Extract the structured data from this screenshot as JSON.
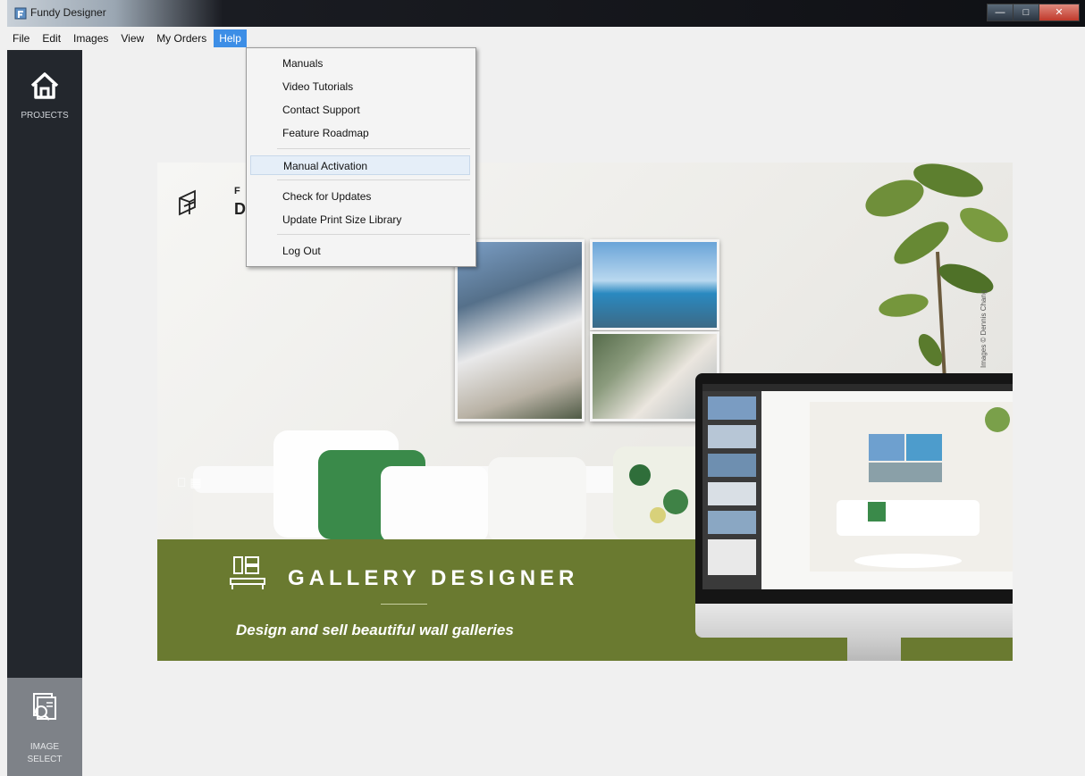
{
  "window": {
    "title": "Fundy Designer",
    "controls": [
      "minimize-icon",
      "maximize-icon",
      "close-icon"
    ]
  },
  "menubar": {
    "items": [
      {
        "label": "File",
        "active": false
      },
      {
        "label": "Edit",
        "active": false
      },
      {
        "label": "Images",
        "active": false
      },
      {
        "label": "View",
        "active": false
      },
      {
        "label": "My Orders",
        "active": false
      },
      {
        "label": "Help",
        "active": true
      }
    ]
  },
  "sidebar": {
    "projects_label": "PROJECTS",
    "image_label": "IMAGE",
    "image_label_2": "SELECT"
  },
  "help_menu": {
    "items": [
      {
        "label": "Manuals"
      },
      {
        "label": "Video Tutorials"
      },
      {
        "label": "Contact Support"
      },
      {
        "label": "Feature Roadmap"
      },
      {
        "label": "Manual Activation",
        "highlighted": true
      },
      {
        "label": "Check for Updates"
      },
      {
        "label": "Update Print Size Library"
      },
      {
        "label": "Log Out"
      }
    ]
  },
  "banner": {
    "logo_line1": "F",
    "logo_line2": "D",
    "title": "GALLERY DESIGNER",
    "tagline": "Design and sell beautiful wall galleries",
    "watermark": "Images © Dennis Chang",
    "os_icons": "apple-icon windows-icon",
    "band_color": "#6a7a30"
  }
}
